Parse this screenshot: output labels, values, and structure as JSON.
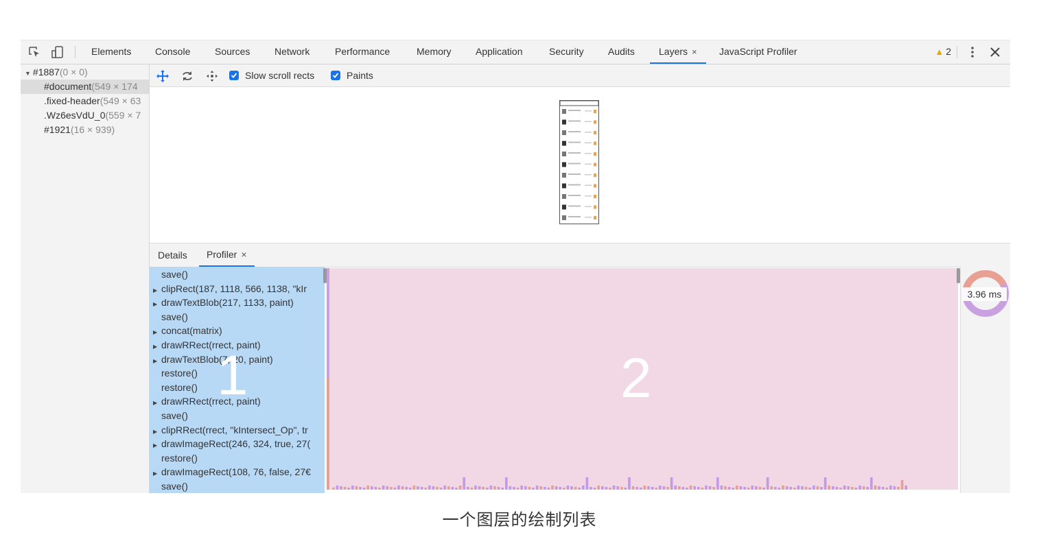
{
  "toolbar": {
    "tabs": [
      "Elements",
      "Console",
      "Sources",
      "Network",
      "Performance",
      "Memory",
      "Application",
      "Security",
      "Audits",
      "Layers",
      "JavaScript Profiler"
    ],
    "active_tab": "Layers",
    "close_glyph": "×",
    "warning_count": "2"
  },
  "layer_tree": [
    {
      "name": "#1887",
      "dims": "(0 × 0)"
    },
    {
      "name": "#document",
      "dims": "(549 × 174"
    },
    {
      "name": ".fixed-header",
      "dims": "(549 × 63"
    },
    {
      "name": ".Wz6esVdU_0",
      "dims": "(559 × 7"
    },
    {
      "name": "#1921",
      "dims": "(16 × 939)"
    }
  ],
  "layers_toolbar": {
    "slow_scroll_label": "Slow scroll rects",
    "paints_label": "Paints",
    "icons": [
      "pan-mode-icon",
      "rotate-mode-icon",
      "reset-transform-icon"
    ]
  },
  "subtabs": {
    "details": "Details",
    "profiler": "Profiler"
  },
  "commands": [
    {
      "text": "save()",
      "expandable": false
    },
    {
      "text": "clipRect(187, 1118, 566, 1138, \"kIr",
      "expandable": true
    },
    {
      "text": "drawTextBlob(217, 1133, paint)",
      "expandable": true
    },
    {
      "text": "save()",
      "expandable": false
    },
    {
      "text": "concat(matrix)",
      "expandable": true
    },
    {
      "text": "drawRRect(rrect, paint)",
      "expandable": true
    },
    {
      "text": "drawTextBlob(7, 20, paint)",
      "expandable": true
    },
    {
      "text": "restore()",
      "expandable": false
    },
    {
      "text": "restore()",
      "expandable": false
    },
    {
      "text": "drawRRect(rrect, paint)",
      "expandable": true
    },
    {
      "text": "save()",
      "expandable": false
    },
    {
      "text": "clipRRect(rrect, \"kIntersect_Op\", tr",
      "expandable": true
    },
    {
      "text": "drawImageRect(246, 324, true, 27(",
      "expandable": true
    },
    {
      "text": "restore()",
      "expandable": false
    },
    {
      "text": "drawImageRect(108, 76, false, 27€",
      "expandable": true
    },
    {
      "text": "save()",
      "expandable": false
    }
  ],
  "profiler": {
    "total_time": "3.96 ms",
    "annotation_1": "1",
    "annotation_2": "2"
  },
  "caption": "一个图层的绘制列表",
  "colors": {
    "accent": "#1a73e8",
    "command_list_bg": "#b8d9f6",
    "timeline_bg": "#f2d7e4",
    "bar_purple": "#c39be4",
    "bar_salmon": "#e8a092",
    "warning": "#e8a400"
  }
}
